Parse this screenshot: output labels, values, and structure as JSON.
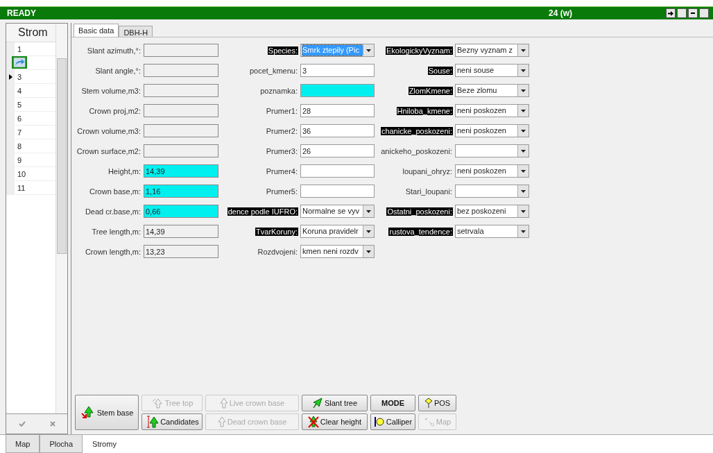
{
  "status_bar": {
    "state": "READY",
    "count": "24 (w)"
  },
  "list": {
    "header": "Strom",
    "items": [
      {
        "label": "1",
        "selected": false
      },
      {
        "selected": false
      },
      {
        "label": "3",
        "selected": true
      },
      {
        "label": "4",
        "selected": false
      },
      {
        "label": "5",
        "selected": false
      },
      {
        "label": "6",
        "selected": false
      },
      {
        "label": "7",
        "selected": false
      },
      {
        "label": "8",
        "selected": false
      },
      {
        "label": "9",
        "selected": false
      },
      {
        "label": "10",
        "selected": false
      },
      {
        "label": "11",
        "selected": false
      }
    ]
  },
  "tabs": [
    {
      "label": "Basic data",
      "selected": true
    },
    {
      "label": "DBH-H",
      "selected": false
    }
  ],
  "columns": [
    [
      {
        "kind": "text",
        "label": "Slant azimuth,°:",
        "marked": false,
        "highlighted": false
      },
      {
        "kind": "text",
        "label": "Slant angle,°:",
        "marked": false,
        "highlighted": false
      },
      {
        "kind": "text",
        "label": "Stem volume,m3:",
        "marked": false,
        "highlighted": false
      },
      {
        "kind": "text",
        "label": "Crown proj,m2:",
        "marked": false,
        "highlighted": false
      },
      {
        "kind": "text",
        "label": "Crown volume,m3:",
        "marked": false,
        "highlighted": false
      },
      {
        "kind": "text",
        "label": "Crown surface,m2:",
        "marked": false,
        "highlighted": false
      },
      {
        "kind": "text",
        "label": "Height,m:",
        "value": "14,39",
        "marked": false,
        "highlighted": true
      },
      {
        "kind": "text",
        "label": "Crown base,m:",
        "value": "1,16",
        "marked": false,
        "highlighted": true
      },
      {
        "kind": "text",
        "label": "Dead cr.base,m:",
        "value": "0,66",
        "marked": false,
        "highlighted": true
      },
      {
        "kind": "text",
        "label": "Tree length,m:",
        "value": "14,39",
        "marked": false,
        "highlighted": false
      },
      {
        "kind": "text",
        "label": "Crown length,m:",
        "value": "13,23",
        "marked": false,
        "highlighted": false
      }
    ],
    [
      {
        "kind": "combo",
        "label": "Species:",
        "value": "Smrk ztepily (Pic",
        "marked": true,
        "selected": true
      },
      {
        "kind": "edit",
        "label": "pocet_kmenu:",
        "value": "3",
        "marked": false,
        "highlighted": false
      },
      {
        "kind": "edit",
        "label": "poznamka:",
        "marked": false,
        "highlighted": true
      },
      {
        "kind": "edit",
        "label": "Prumer1:",
        "value": "28",
        "marked": false,
        "highlighted": false
      },
      {
        "kind": "edit",
        "label": "Prumer2:",
        "value": "36",
        "marked": false,
        "highlighted": false
      },
      {
        "kind": "edit",
        "label": "Prumer3:",
        "value": "26",
        "marked": false,
        "highlighted": false
      },
      {
        "kind": "edit",
        "label": "Prumer4:",
        "marked": false,
        "highlighted": false
      },
      {
        "kind": "edit",
        "label": "Prumer5:",
        "marked": false,
        "highlighted": false
      },
      {
        "kind": "combo",
        "label": "dence podle IUFRO:",
        "value": "Normalne se vyv",
        "marked": true,
        "selected": false
      },
      {
        "kind": "combo",
        "label": "TvarKoruny:",
        "value": "Koruna pravidelr",
        "marked": true,
        "selected": false
      },
      {
        "kind": "combo",
        "label": "Rozdvojeni:",
        "value": "kmen neni rozdv",
        "marked": false,
        "selected": false
      }
    ],
    [
      {
        "kind": "combo",
        "label": "EkologickyVyznam:",
        "value": "Bezny vyznam z",
        "marked": true,
        "selected": false
      },
      {
        "kind": "combo",
        "label": "Souse:",
        "value": "neni souse",
        "marked": true,
        "selected": false
      },
      {
        "kind": "combo",
        "label": "ZlomKmene:",
        "value": "Beze zlomu",
        "marked": true,
        "selected": false
      },
      {
        "kind": "combo",
        "label": "Hniloba_kmene:",
        "value": "neni poskozen",
        "marked": true,
        "selected": false
      },
      {
        "kind": "combo",
        "label": "chanicke_poskozeni:",
        "value": "neni poskozen",
        "marked": true,
        "selected": false
      },
      {
        "kind": "combo",
        "label": "anickeho_poskozeni:",
        "marked": false,
        "selected": false
      },
      {
        "kind": "combo",
        "label": "loupani_ohryz:",
        "value": "neni poskozen",
        "marked": false,
        "selected": false
      },
      {
        "kind": "combo",
        "label": "Stari_loupani:",
        "marked": false,
        "selected": false
      },
      {
        "kind": "combo",
        "label": "Ostatni_poskozeni:",
        "value": "bez poskozeni",
        "marked": true,
        "selected": false
      },
      {
        "kind": "combo",
        "label": "rustova_tendence:",
        "value": "setrvala",
        "marked": true,
        "selected": false
      }
    ]
  ],
  "buttons": [
    {
      "label": "Stem base",
      "disabled": false
    },
    {
      "label": "Tree top",
      "disabled": true
    },
    {
      "label": "Candidates",
      "disabled": false
    },
    {
      "label": "Live crown base",
      "disabled": true
    },
    {
      "label": "Dead crown base",
      "disabled": true
    },
    {
      "label": "Slant tree",
      "disabled": false
    },
    {
      "label": "Clear height",
      "disabled": false
    },
    {
      "label": "MODE",
      "disabled": false
    },
    {
      "label": "Calliper",
      "disabled": false
    },
    {
      "label": "POS",
      "disabled": false
    },
    {
      "label": "Map",
      "disabled": true
    }
  ],
  "bottom_tabs": [
    {
      "label": "Map",
      "selected": false
    },
    {
      "label": "Plocha",
      "selected": false
    },
    {
      "label": "Stromy",
      "selected": true
    }
  ]
}
